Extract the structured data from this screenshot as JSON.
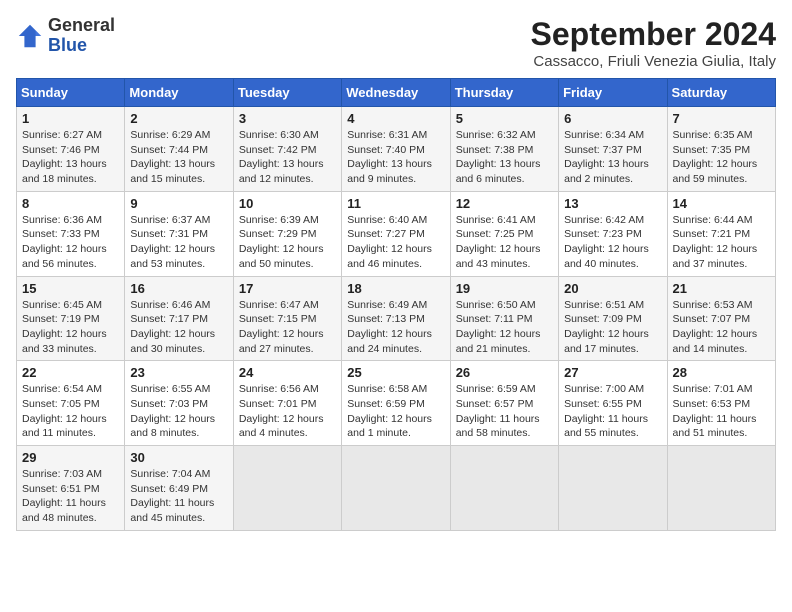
{
  "header": {
    "logo_general": "General",
    "logo_blue": "Blue",
    "title": "September 2024",
    "subtitle": "Cassacco, Friuli Venezia Giulia, Italy"
  },
  "calendar": {
    "columns": [
      "Sunday",
      "Monday",
      "Tuesday",
      "Wednesday",
      "Thursday",
      "Friday",
      "Saturday"
    ],
    "weeks": [
      [
        {
          "day": "",
          "info": ""
        },
        {
          "day": "2",
          "info": "Sunrise: 6:29 AM\nSunset: 7:44 PM\nDaylight: 13 hours\nand 15 minutes."
        },
        {
          "day": "3",
          "info": "Sunrise: 6:30 AM\nSunset: 7:42 PM\nDaylight: 13 hours\nand 12 minutes."
        },
        {
          "day": "4",
          "info": "Sunrise: 6:31 AM\nSunset: 7:40 PM\nDaylight: 13 hours\nand 9 minutes."
        },
        {
          "day": "5",
          "info": "Sunrise: 6:32 AM\nSunset: 7:38 PM\nDaylight: 13 hours\nand 6 minutes."
        },
        {
          "day": "6",
          "info": "Sunrise: 6:34 AM\nSunset: 7:37 PM\nDaylight: 13 hours\nand 2 minutes."
        },
        {
          "day": "7",
          "info": "Sunrise: 6:35 AM\nSunset: 7:35 PM\nDaylight: 12 hours\nand 59 minutes."
        }
      ],
      [
        {
          "day": "1",
          "info": "Sunrise: 6:27 AM\nSunset: 7:46 PM\nDaylight: 13 hours\nand 18 minutes."
        },
        {
          "day": "",
          "info": ""
        },
        {
          "day": "",
          "info": ""
        },
        {
          "day": "",
          "info": ""
        },
        {
          "day": "",
          "info": ""
        },
        {
          "day": "",
          "info": ""
        },
        {
          "day": "",
          "info": ""
        }
      ],
      [
        {
          "day": "8",
          "info": "Sunrise: 6:36 AM\nSunset: 7:33 PM\nDaylight: 12 hours\nand 56 minutes."
        },
        {
          "day": "9",
          "info": "Sunrise: 6:37 AM\nSunset: 7:31 PM\nDaylight: 12 hours\nand 53 minutes."
        },
        {
          "day": "10",
          "info": "Sunrise: 6:39 AM\nSunset: 7:29 PM\nDaylight: 12 hours\nand 50 minutes."
        },
        {
          "day": "11",
          "info": "Sunrise: 6:40 AM\nSunset: 7:27 PM\nDaylight: 12 hours\nand 46 minutes."
        },
        {
          "day": "12",
          "info": "Sunrise: 6:41 AM\nSunset: 7:25 PM\nDaylight: 12 hours\nand 43 minutes."
        },
        {
          "day": "13",
          "info": "Sunrise: 6:42 AM\nSunset: 7:23 PM\nDaylight: 12 hours\nand 40 minutes."
        },
        {
          "day": "14",
          "info": "Sunrise: 6:44 AM\nSunset: 7:21 PM\nDaylight: 12 hours\nand 37 minutes."
        }
      ],
      [
        {
          "day": "15",
          "info": "Sunrise: 6:45 AM\nSunset: 7:19 PM\nDaylight: 12 hours\nand 33 minutes."
        },
        {
          "day": "16",
          "info": "Sunrise: 6:46 AM\nSunset: 7:17 PM\nDaylight: 12 hours\nand 30 minutes."
        },
        {
          "day": "17",
          "info": "Sunrise: 6:47 AM\nSunset: 7:15 PM\nDaylight: 12 hours\nand 27 minutes."
        },
        {
          "day": "18",
          "info": "Sunrise: 6:49 AM\nSunset: 7:13 PM\nDaylight: 12 hours\nand 24 minutes."
        },
        {
          "day": "19",
          "info": "Sunrise: 6:50 AM\nSunset: 7:11 PM\nDaylight: 12 hours\nand 21 minutes."
        },
        {
          "day": "20",
          "info": "Sunrise: 6:51 AM\nSunset: 7:09 PM\nDaylight: 12 hours\nand 17 minutes."
        },
        {
          "day": "21",
          "info": "Sunrise: 6:53 AM\nSunset: 7:07 PM\nDaylight: 12 hours\nand 14 minutes."
        }
      ],
      [
        {
          "day": "22",
          "info": "Sunrise: 6:54 AM\nSunset: 7:05 PM\nDaylight: 12 hours\nand 11 minutes."
        },
        {
          "day": "23",
          "info": "Sunrise: 6:55 AM\nSunset: 7:03 PM\nDaylight: 12 hours\nand 8 minutes."
        },
        {
          "day": "24",
          "info": "Sunrise: 6:56 AM\nSunset: 7:01 PM\nDaylight: 12 hours\nand 4 minutes."
        },
        {
          "day": "25",
          "info": "Sunrise: 6:58 AM\nSunset: 6:59 PM\nDaylight: 12 hours\nand 1 minute."
        },
        {
          "day": "26",
          "info": "Sunrise: 6:59 AM\nSunset: 6:57 PM\nDaylight: 11 hours\nand 58 minutes."
        },
        {
          "day": "27",
          "info": "Sunrise: 7:00 AM\nSunset: 6:55 PM\nDaylight: 11 hours\nand 55 minutes."
        },
        {
          "day": "28",
          "info": "Sunrise: 7:01 AM\nSunset: 6:53 PM\nDaylight: 11 hours\nand 51 minutes."
        }
      ],
      [
        {
          "day": "29",
          "info": "Sunrise: 7:03 AM\nSunset: 6:51 PM\nDaylight: 11 hours\nand 48 minutes."
        },
        {
          "day": "30",
          "info": "Sunrise: 7:04 AM\nSunset: 6:49 PM\nDaylight: 11 hours\nand 45 minutes."
        },
        {
          "day": "",
          "info": ""
        },
        {
          "day": "",
          "info": ""
        },
        {
          "day": "",
          "info": ""
        },
        {
          "day": "",
          "info": ""
        },
        {
          "day": "",
          "info": ""
        }
      ]
    ]
  }
}
